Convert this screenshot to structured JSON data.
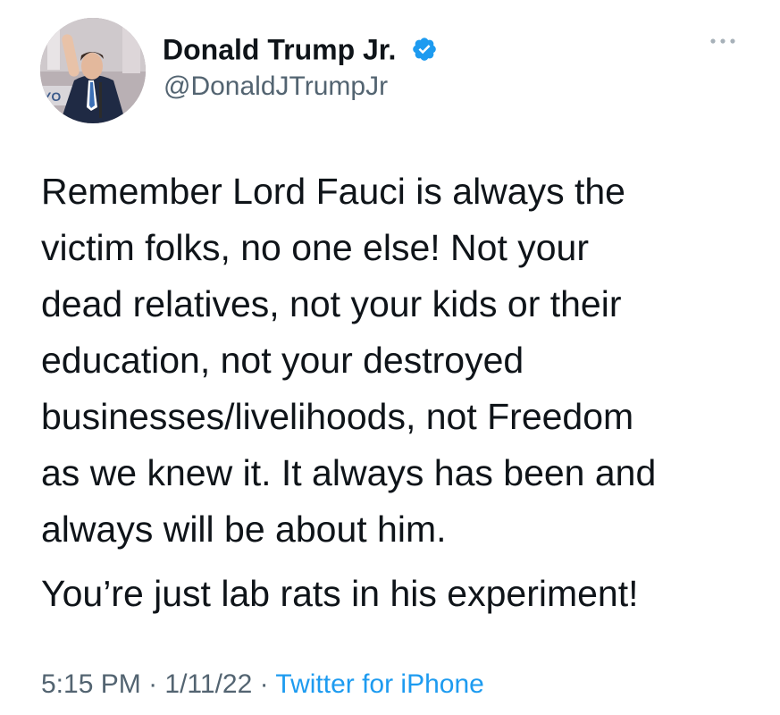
{
  "author": {
    "display_name": "Donald Trump Jr.",
    "handle": "@DonaldJTrumpJr",
    "avatar_icon": "profile-photo",
    "verified_icon": "verified-badge-icon",
    "avatar_sign_text": "YO"
  },
  "more_icon": "more-horizontal-icon",
  "tweet": {
    "paragraph_1": "Remember Lord Fauci is always the\nvictim folks, no one else! Not your\ndead relatives, not your kids or their\neducation, not your destroyed\nbusinesses/livelihoods, not Freedom\nas we knew it. It always has been and\nalways will be about him.",
    "paragraph_2": "You’re just lab rats in his experiment!"
  },
  "meta": {
    "time": "5:15 PM",
    "separator": " · ",
    "date": "1/11/22",
    "source": "Twitter for iPhone"
  },
  "colors": {
    "text": "#0f1419",
    "secondary": "#536471",
    "link": "#1d9bf0",
    "verified": "#1d9bf0"
  }
}
